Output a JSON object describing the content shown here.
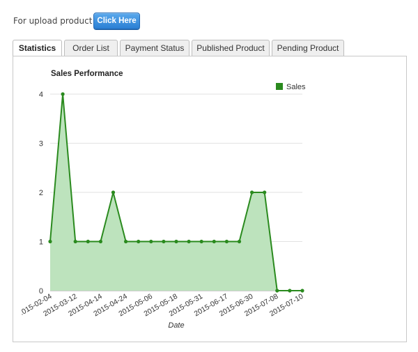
{
  "upload": {
    "text": "For upload product",
    "button_label": "Click Here"
  },
  "tabs": [
    {
      "label": "Statistics",
      "active": true
    },
    {
      "label": "Order List",
      "active": false
    },
    {
      "label": "Payment Status",
      "active": false
    },
    {
      "label": "Published Product",
      "active": false
    },
    {
      "label": "Pending Product",
      "active": false
    }
  ],
  "colors": {
    "line": "#2a8a1e",
    "fill": "#bde3bd",
    "button": "#3b8fe0"
  },
  "chart_data": {
    "type": "area",
    "title": "Sales Performance",
    "xlabel": "Date",
    "ylabel": "",
    "ylim": [
      0,
      4
    ],
    "yticks": [
      0,
      1,
      2,
      3,
      4
    ],
    "grid": true,
    "legend": "top-right",
    "xtick_labels": [
      ".015-02-04",
      "2015-03-12",
      "2015-04-14",
      "2015-04-24",
      "2015-05-06",
      "2015-05-18",
      "2015-05-31",
      "2015-06-17",
      "2015-06-30",
      "2015-07-08",
      "2015-07-10"
    ],
    "series": [
      {
        "name": "Sales",
        "values": [
          1,
          4,
          1,
          1,
          1,
          2,
          1,
          1,
          1,
          1,
          1,
          1,
          1,
          1,
          1,
          1,
          2,
          2,
          0,
          0,
          0
        ]
      }
    ]
  }
}
